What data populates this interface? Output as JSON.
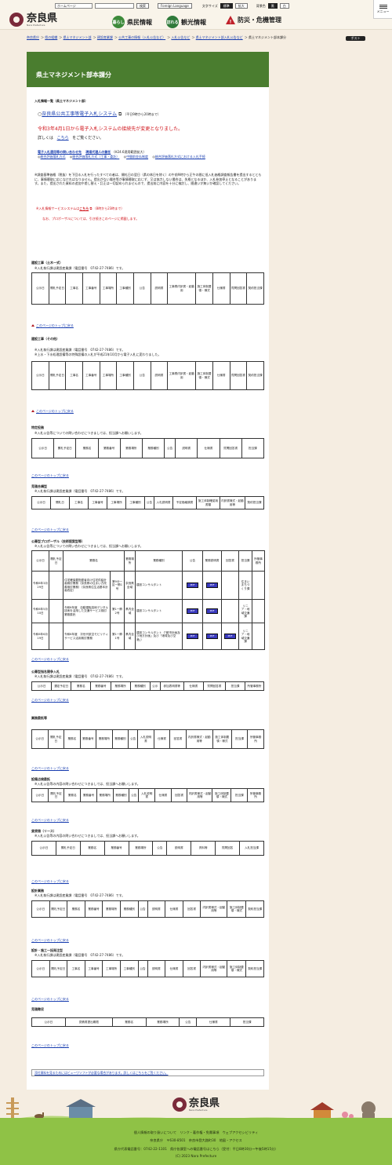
{
  "header": {
    "lang_select": "ホームページ",
    "search_btn": "検索",
    "foreign_btn": "Foreign Language",
    "font_size_label": "文字サイズ",
    "font_std": "標準",
    "font_big": "拡大",
    "color_label": "背景色",
    "color_black": "黒",
    "color_white": "白",
    "logo_text": "奈良県",
    "logo_sub": "Nara Prefecture",
    "nav1": "県民情報",
    "nav1_icon": "暮らし",
    "nav2": "観光情報",
    "nav2_icon": "訪れる",
    "nav3": "防災・危機管理",
    "menu": "メニュー"
  },
  "breadcrumb": [
    "奈良県庁",
    "県の組織",
    "県土マネジメント部",
    "建設産業課",
    "公共工事の情報（入札公告など）",
    "入札公告など",
    "県土マネジメント部入札公告など",
    "県土マネジメント部本課分"
  ],
  "post_btn": "ポスト",
  "page_title": "県土マネジメント部本課分",
  "intro": {
    "heading": "入札情報一覧（県土マネジメント部）",
    "system_link": "奈良県公共工事等電子入札システム",
    "system_note": "（平日9時から20時まで）",
    "notice_red": "令和3年4月1日から電子入札システムの接続先が変更となりました。",
    "notice_detail_pre": "詳しくは",
    "notice_detail_link": "こちら",
    "notice_detail_post": "をご覧ください。",
    "link_inquiry": "電子入札運用等の問い合わせ先",
    "link_inquiry2": "現場代理人の兼任",
    "link_inquiry2_note": "（H24.6適用範囲拡大）",
    "link_a": "総合評価落札方式",
    "link_b": "総合評価落札方式（工事・委託）",
    "link_c": "中間前金払制度",
    "link_d": "総合評価落札方式における入札手続",
    "para1": "※調査基準価格（税抜）を下回る入札を行ったすべての者は、開札日の翌日（県の休日を除く）の午前9時から正午の間に低入札価格調査報告書を提出するとともに、事情聴取に応じなければなりません。提出がない場合等が事情聴取に応じず、又は協力しない場合は、失格となるほか、入札参加停止となることがあります。また、提出された資料の追加や差し替え・訂正は一切認められませんので、提出前に内容を十分に検討し、間違いが無いか確認してください。",
    "red_link_pre": "入札情報サービスシステムは",
    "red_link": "こちら",
    "red_link_note": "（8時から23時まで）",
    "red_note": "なお、プロポーザルについては、引き続きこのページに掲載します。"
  },
  "top_link": "このページのトップに戻る",
  "sections": [
    {
      "title": "建設工事（土木一式）",
      "note": "※入札執行課は建設産業課（電話番号　0742-27-7486）です。",
      "cols": [
        "公示日",
        "開札予定日",
        "工事名",
        "工事番号",
        "工事場所",
        "工事種別",
        "公告",
        "説明書",
        "工事費内訳書・起動用",
        "施工体制要領・様式",
        "仕様書",
        "質問回答書",
        "契約担当課"
      ]
    },
    {
      "title": "建設工事（その他）",
      "note": "※入札執行課は建設産業課（電話番号　0742-27-7486）です。",
      "note2": "※上水・下水処理設備等の特殊設備の入札が平成21年10月から電子入札に変わりました。",
      "cols": [
        "公示日",
        "開札予定日",
        "工事名",
        "工事番号",
        "工事場所",
        "工事種別",
        "公告",
        "説明書",
        "工事費内訳書・起動用",
        "施工体制要領・様式",
        "仕様書",
        "質問回答書",
        "契約担当課"
      ]
    },
    {
      "title": "特定役務",
      "note": "※入札公告等についての問い合わせにつきましては、担当課へお願いします。",
      "cols": [
        "公示日",
        "開札予定日",
        "業務名",
        "業務番号",
        "業務場所",
        "業務種別",
        "公告",
        "説明書",
        "仕様書",
        "質問回答書",
        "担当課"
      ]
    },
    {
      "title": "見積合構型",
      "note": "※入札執行課は建設産業課（電話番号　0742-27-7486）です。",
      "cols": [
        "公示日",
        "開札日",
        "工事名",
        "工事番号",
        "工事場所",
        "工事種別",
        "公告",
        "入札説明書",
        "予定価格調書",
        "施工体制確認用書類",
        "内訳書様式・起動用等",
        "契約担当課"
      ]
    },
    {
      "title": "公募型プロポーザル（技術提案型等）",
      "note": "※入札公告等についての問い合わせにつきましては、担当課へお願いします。",
      "cols": [
        "公示日",
        "開札予定日",
        "業務名",
        "業務場所",
        "業務種別",
        "公告",
        "業務説明書",
        "回答書",
        "担当課",
        "所管事務所"
      ],
      "rows": [
        {
          "date": "令和6年3月29日",
          "name": "住宅確保要配慮者向け住宅供給計画検討業務（奈良県の住まい方改善検討業務）（奈良県住生活基本計画改定）",
          "place": "第9分一区一節1号",
          "type": "奈良県全域",
          "kind": "建設コンサルタント",
          "dept": "住まいまちづくり課"
        },
        {
          "date": "令和6年5月10日",
          "name": "令和6年度　自動運転技術デジタル技術を活用した交通サービス検討業務委託",
          "place": "第1一節2号",
          "type": "県内全域",
          "kind": "建設コンサルタント",
          "dept": "リニア・地域交通課"
        },
        {
          "date": "令和6年6月19日",
          "name": "令和6年度　次世代航空モビリティサービス活用検討業務",
          "place": "第1一節1号",
          "type": "県内全域",
          "kind": "建設コンサルタント（「都市計画及び地方計画」及び「港湾及び空港」）",
          "dept": "リニア・地域交通課"
        }
      ],
      "pdf": "PDF"
    },
    {
      "title": "公募型指名競争入札",
      "note": "※入札執行課は建設産業課（電話番号　0742-27-7486）です。",
      "cols": [
        "公示日",
        "選定予定日",
        "業務名",
        "業務番号",
        "業務場所",
        "業務種別",
        "公示",
        "参加表明書等",
        "仕様書",
        "質問回答書",
        "担当課",
        "所管事務所"
      ]
    },
    {
      "title": "業務委託等",
      "note": "",
      "cols": [
        "公示日",
        "開札予定日",
        "業務名",
        "業務番号",
        "業務場所",
        "業務種別",
        "公告",
        "入札説明書",
        "仕様書",
        "回答書",
        "内訳書様式・起動用等",
        "施工体制要領・様式",
        "担当課",
        "所管事務所"
      ]
    },
    {
      "title": "設備点検委託",
      "note": "※入札公告等の内容の問い合わせにつきましては、担当課へお願いします。",
      "cols": [
        "公示日",
        "開札予定日",
        "業務名",
        "業務番号",
        "業務場所",
        "業務種別",
        "公告",
        "入札説明書",
        "仕様書",
        "回答書",
        "内訳書様式・起動用等",
        "施工体制要領・様式",
        "担当課",
        "所管事務所"
      ]
    },
    {
      "title": "賃貸借（リース）",
      "note": "※入札公告等の内容の問い合わせにつきましては、担当課へお願いします。",
      "cols": [
        "公示日",
        "開札予定日",
        "業務名",
        "業務番号",
        "業務場所",
        "公告",
        "説明書",
        "資料等",
        "質問回答",
        "入札担当課"
      ]
    },
    {
      "title": "設計業務",
      "note": "※入札執行課は建設産業課（電話番号　0742-27-7486）です。",
      "cols": [
        "公示日",
        "開札予定日",
        "業務名",
        "業務番号",
        "業務場所",
        "業務種別",
        "公告",
        "説明書",
        "仕様書",
        "回答書",
        "内訳書様式・起動用等",
        "施工体制要領・様式",
        "契約担当課"
      ]
    },
    {
      "title": "設計・施工一括発注型",
      "note": "※入札執行課は建設産業課（電話番号　0742-27-7486）です。",
      "cols": [
        "公示日",
        "開札予定日",
        "工事名",
        "工事番号",
        "工事場所",
        "工事種別",
        "公告",
        "説明書",
        "仕様書",
        "回答書",
        "内訳書様式・起動用等",
        "施工体制要領・様式",
        "契約担当課"
      ]
    },
    {
      "title": "見積徴収",
      "note": "",
      "cols": [
        "公示日",
        "見積書提出期限",
        "業務名",
        "業務場所",
        "公告",
        "仕様書",
        "担当課"
      ]
    }
  ],
  "viewer_note": "添付資料を見るためにはビューワソフトが必要な場合があります。詳しくはこちらをご覧ください。",
  "footer": {
    "logo": "奈良県",
    "logo_sub": "Nara Prefecture",
    "line1": "個人情報の取り扱いについて　リンク・著作権・免責事項　ウェブアクセシビリティ",
    "line2": "奈良県庁　〒630-8501　奈良市登大路町30　地図・アクセス",
    "line3": "県庁代表電話番号：0742-22-1101　県庁各課室への電話番号はこちら（受付：平日8時30分〜午後5時15分）",
    "copyright": "(C) 2023 Nara Prefecture"
  }
}
